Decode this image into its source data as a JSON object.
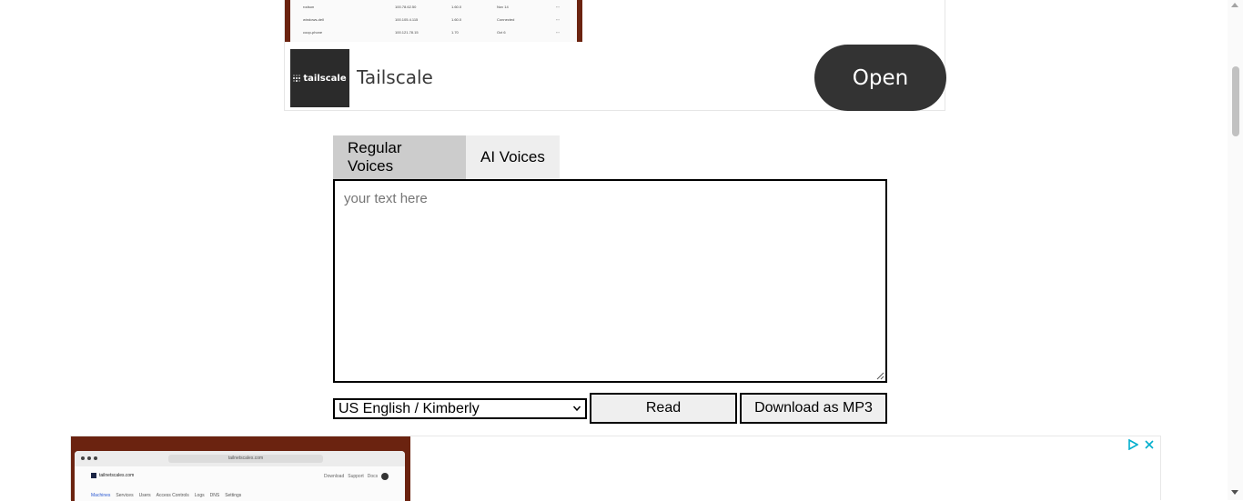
{
  "top_ad": {
    "machine_rows": [
      {
        "name": "rodson",
        "ip": "100.78.62.50",
        "ver": "1.60.0",
        "status": "Nov 14"
      },
      {
        "name": "windows-dell",
        "ip": "100.105.4.115",
        "ver": "1.60.0",
        "status": "Connected"
      },
      {
        "name": "coop-phone",
        "ip": "100.121.78.15",
        "ver": "1.70",
        "status": "Oct 6"
      }
    ],
    "logo_text": "tailscale",
    "brand_name": "Tailscale",
    "open_label": "Open"
  },
  "tabs": [
    {
      "label": "Regular Voices",
      "active": true
    },
    {
      "label": "AI Voices",
      "active": false
    }
  ],
  "text_input": {
    "placeholder": "your text here",
    "value": ""
  },
  "voice_select": {
    "selected": "US English / Kimberly"
  },
  "buttons": {
    "read": "Read",
    "download": "Download as MP3"
  },
  "bottom_ad": {
    "url": "tailnetscales.com",
    "site": "tailnetscales.com",
    "links": [
      "Download",
      "Support",
      "Docs"
    ],
    "nav": [
      "Machines",
      "Services",
      "Users",
      "Access Controls",
      "Logs",
      "DNS",
      "Settings"
    ]
  },
  "colors": {
    "tab_active": "#cccccc",
    "tab_inactive": "#eeeeee",
    "ad_button": "#333333",
    "ad_accent": "#00aecd",
    "frame_brown": "#6b2310"
  }
}
